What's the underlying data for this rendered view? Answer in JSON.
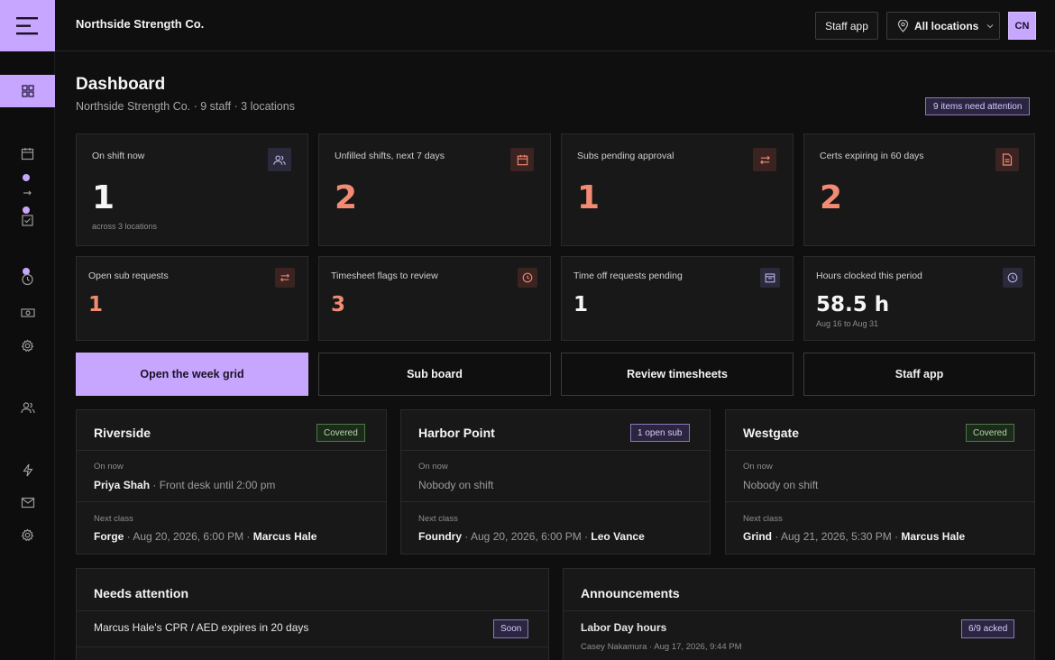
{
  "header": {
    "org_name": "Northside Strength Co.",
    "staff_app_label": "Staff app",
    "locations_label": "All locations",
    "avatar_initials": "CN"
  },
  "page": {
    "title": "Dashboard",
    "subtitle": "Northside Strength Co. · 9 staff · 3 locations",
    "attention_badge": "9 items need attention"
  },
  "sidebar": {
    "items": [
      {
        "name": "dashboard",
        "icon": "grid-icon",
        "active": true
      },
      {
        "name": "schedule",
        "icon": "calendar-icon"
      },
      {
        "name": "subs",
        "icon": "swap-icon"
      },
      {
        "name": "timesheets",
        "icon": "checklist-icon"
      },
      {
        "name": "time-off",
        "icon": "clock-icon"
      },
      {
        "name": "payroll",
        "icon": "cash-icon"
      },
      {
        "name": "settings",
        "icon": "gear-icon"
      },
      {
        "name": "staff",
        "icon": "people-icon"
      },
      {
        "name": "automations",
        "icon": "bolt-icon"
      },
      {
        "name": "messages",
        "icon": "mail-icon"
      },
      {
        "name": "admin-settings",
        "icon": "gear-icon"
      }
    ]
  },
  "stats": [
    {
      "label": "On shift now",
      "value": "1",
      "note": "across 3 locations",
      "icon": "people-icon"
    },
    {
      "label": "Unfilled shifts, next 7 days",
      "value": "2",
      "note": "",
      "icon": "calendar-icon"
    },
    {
      "label": "Subs pending approval",
      "value": "1",
      "note": "",
      "icon": "swap-icon"
    },
    {
      "label": "Certs expiring in 60 days",
      "value": "2",
      "note": "",
      "icon": "document-icon"
    },
    {
      "label": "Open sub requests",
      "value": "1",
      "note": "",
      "icon": "swap-icon"
    },
    {
      "label": "Timesheet flags to review",
      "value": "3",
      "note": "",
      "icon": "clock-icon"
    },
    {
      "label": "Time off requests pending",
      "value": "1",
      "note": "",
      "icon": "calendar-icon"
    },
    {
      "label": "Hours clocked this period",
      "value": "58.5 h",
      "note": "Aug 16 to Aug 31",
      "icon": "clock-icon"
    }
  ],
  "actions": [
    "Open the week grid",
    "Sub board",
    "Review timesheets",
    "Staff app"
  ],
  "locations": [
    {
      "name": "Riverside",
      "status": "Covered",
      "on_now_label": "On now",
      "on_now_name": "Priya Shah",
      "on_now_detail": " · Front desk until 2:00 pm",
      "next_label": "Next class",
      "class_name": "Forge",
      "class_time": " · Aug 20, 2026, 6:00 PM · ",
      "instructor": "Marcus Hale"
    },
    {
      "name": "Harbor Point",
      "status": "1 open sub",
      "on_now_label": "On now",
      "on_now_name": "",
      "on_now_detail": "Nobody on shift",
      "next_label": "Next class",
      "class_name": "Foundry",
      "class_time": " · Aug 20, 2026, 6:00 PM · ",
      "instructor": "Leo Vance"
    },
    {
      "name": "Westgate",
      "status": "Covered",
      "on_now_label": "On now",
      "on_now_name": "",
      "on_now_detail": "Nobody on shift",
      "next_label": "Next class",
      "class_name": "Grind",
      "class_time": " · Aug 21, 2026, 5:30 PM · ",
      "instructor": "Marcus Hale"
    }
  ],
  "needs_attention": {
    "title": "Needs attention",
    "items": [
      {
        "text": "Marcus Hale's CPR / AED expires in 20 days",
        "tag": "Soon"
      }
    ]
  },
  "announcements": {
    "title": "Announcements",
    "items": [
      {
        "title": "Labor Day hours",
        "meta": "Casey Nakamura · Aug 17, 2026, 9:44 PM",
        "tag": "6/9 acked"
      }
    ]
  },
  "colors": {
    "accent": "#c7a6ff",
    "alert": "#f28b74",
    "background": "#0f0f0f",
    "card": "#171817"
  }
}
